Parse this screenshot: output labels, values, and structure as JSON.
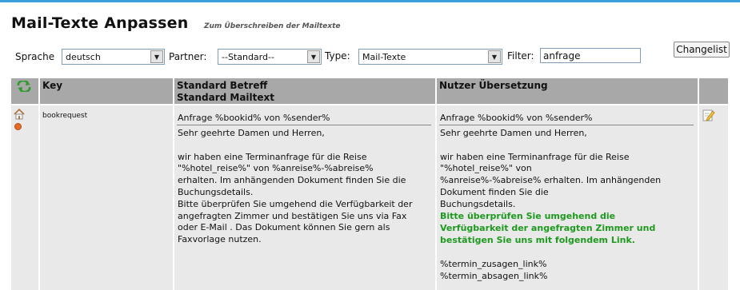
{
  "header": {
    "title": "Mail-Texte Anpassen",
    "subtitle": "Zum Überschreiben der Mailtexte"
  },
  "filters": {
    "sprache_label": "Sprache",
    "sprache_value": "deutsch",
    "partner_label": "Partner:",
    "partner_value": "--Standard--",
    "type_label": "Type:",
    "type_value": "Mail-Texte",
    "filter_label": "Filter:",
    "filter_value": "anfrage",
    "changelist_label": "Changelist"
  },
  "table": {
    "col_key": "Key",
    "col_standard_line1": "Standard Betreff",
    "col_standard_line2": "Standard Mailtext",
    "col_user": "Nutzer Übersetzung",
    "row": {
      "key": "bookrequest",
      "std_subject": "Anfrage %bookid% von %sender%",
      "std_body": "Sehr geehrte Damen und Herren,\n\nwir haben eine Terminanfrage für die Reise\n\"%hotel_reise%\" von %anreise%-%abreise%\nerhalten. Im anhängenden Dokument finden Sie die\nBuchungsdetails.\nBitte überprüfen Sie umgehend die Verfügbarkeit der\nangefragten Zimmer und bestätigen Sie uns via Fax\noder E-Mail . Das Dokument können Sie gern als\nFaxvorlage nutzen.",
      "user_subject": "Anfrage %bookid% von %sender%",
      "user_body_top": "Sehr geehrte Damen und Herren,\n\nwir haben eine Terminanfrage für die Reise\n\"%hotel_reise%\" von\n%anreise%-%abreise% erhalten. Im anhängenden\nDokument finden Sie die\nBuchungsdetails.",
      "user_body_green": "Bitte überprüfen Sie umgehend die\nVerfügbarkeit der angefragten Zimmer und\nbestätigen Sie uns mit folgendem Link.",
      "user_body_bottom": "%termin_zusagen_link%\n%termin_absagen_link%"
    }
  },
  "icons": {
    "refresh": "refresh-icon",
    "home": "home-icon",
    "dot": "status-dot-icon",
    "edit": "edit-pencil-icon"
  },
  "colors": {
    "accent_line": "#3d9fd8",
    "header_bg": "#a8a8a8",
    "cell_bg": "#e9e9e9",
    "green_text": "#1e9a1e"
  }
}
